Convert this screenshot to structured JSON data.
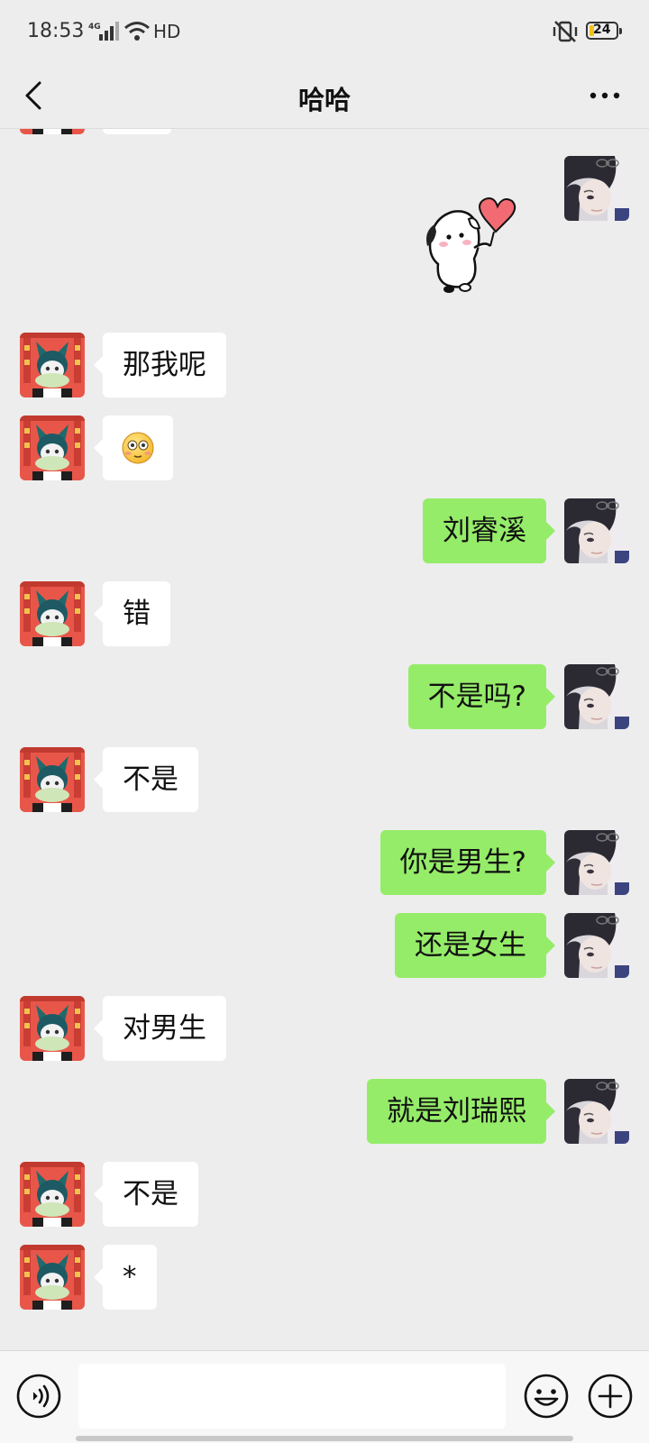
{
  "status_bar": {
    "time": "18:53",
    "network": "4G",
    "hd": "HD",
    "battery": "24"
  },
  "header": {
    "title": "哈哈"
  },
  "messages": [
    {
      "side": "right",
      "type": "sticker",
      "sticker": "puppy-holding-heart-balloon"
    },
    {
      "side": "left",
      "text": "那我呢"
    },
    {
      "side": "left",
      "type": "emoji",
      "text": "😳"
    },
    {
      "side": "right",
      "text": "刘睿溪"
    },
    {
      "side": "left",
      "text": "错"
    },
    {
      "side": "right",
      "text": "不是吗?"
    },
    {
      "side": "left",
      "text": "不是"
    },
    {
      "side": "right",
      "text": "你是男生?"
    },
    {
      "side": "right",
      "text": "还是女生"
    },
    {
      "side": "left",
      "text": "对男生"
    },
    {
      "side": "right",
      "text": "就是刘瑞熙"
    },
    {
      "side": "left",
      "text": "不是"
    },
    {
      "side": "left",
      "text": "*"
    }
  ],
  "input_bar": {
    "placeholder": ""
  },
  "colors": {
    "background": "#ededed",
    "sent_bubble": "#95ec69",
    "received_bubble": "#ffffff"
  }
}
